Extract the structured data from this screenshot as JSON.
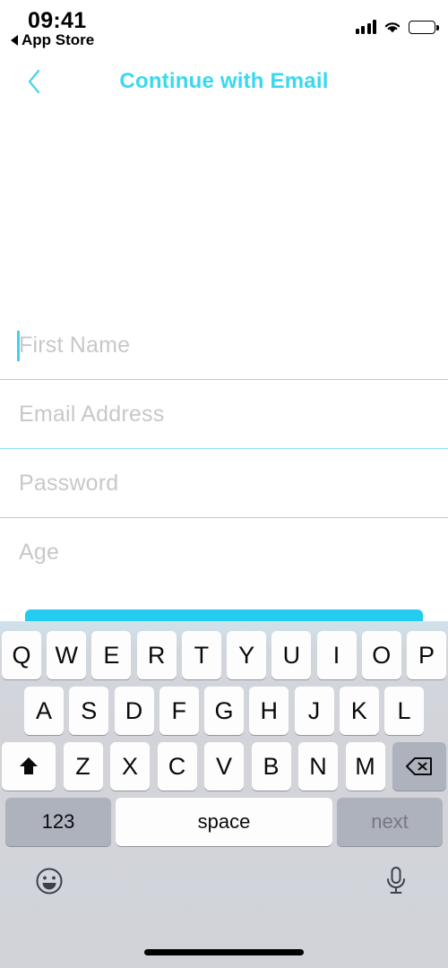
{
  "status_bar": {
    "time": "09:41",
    "return_label": "App Store",
    "icons": [
      "back-triangle-icon",
      "cellular-signal-icon",
      "wifi-icon",
      "battery-icon"
    ]
  },
  "nav": {
    "back_icon": "chevron-left-icon",
    "title": "Continue with Email",
    "accent_color": "#38d9ef"
  },
  "form": {
    "fields": [
      {
        "name": "first-name",
        "placeholder": "First Name",
        "value": "",
        "focused": true,
        "divider": true
      },
      {
        "name": "email-address",
        "placeholder": "Email Address",
        "value": "",
        "focused": false,
        "divider": true
      },
      {
        "name": "password",
        "placeholder": "Password",
        "value": "",
        "focused": false,
        "divider": true
      },
      {
        "name": "age",
        "placeholder": "Age",
        "value": "",
        "focused": false,
        "divider": false
      }
    ],
    "placeholder_color": "#c8c8cc",
    "divider_color": "#8fdcf0"
  },
  "submit": {
    "label": "",
    "color": "#24cdf0"
  },
  "keyboard": {
    "type": "qwerty-uppercase",
    "background_color": "#d1d3d9",
    "row1": [
      "Q",
      "W",
      "E",
      "R",
      "T",
      "Y",
      "U",
      "I",
      "O",
      "P"
    ],
    "row2": [
      "A",
      "S",
      "D",
      "F",
      "G",
      "H",
      "J",
      "K",
      "L"
    ],
    "row3_letters": [
      "Z",
      "X",
      "C",
      "V",
      "B",
      "N",
      "M"
    ],
    "shift_icon": "shift-arrow-icon",
    "delete_icon": "backspace-icon",
    "numbers_label": "123",
    "space_label": "space",
    "return_label": "next",
    "emoji_icon": "smiley-face-icon",
    "mic_icon": "microphone-icon"
  },
  "home_indicator": "home-indicator-bar"
}
